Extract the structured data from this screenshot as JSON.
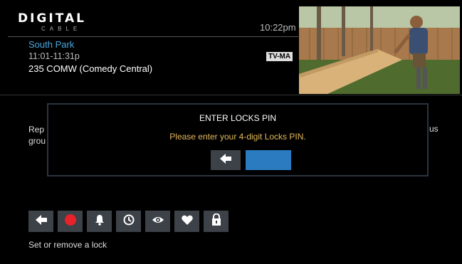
{
  "header": {
    "logo_main": "DIGITAL",
    "logo_sub": "CABLE",
    "time": "10:22pm"
  },
  "program": {
    "title": "South Park",
    "time_range": "11:01-11:31p",
    "channel": "235 COMW (Comedy Central)",
    "rating": "TV-MA"
  },
  "description": {
    "left_line1": "Rep",
    "left_line2": "grou",
    "right_line1": "us"
  },
  "dialog": {
    "title": "ENTER LOCKS PIN",
    "message": "Please enter your 4-digit Locks PIN.",
    "back_icon": "left-arrow-icon",
    "pin_value": ""
  },
  "actions": [
    {
      "icon": "back-arrow-icon"
    },
    {
      "icon": "record-icon",
      "color": "#e8222a"
    },
    {
      "icon": "bell-icon"
    },
    {
      "icon": "clock-icon"
    },
    {
      "icon": "eye-icon"
    },
    {
      "icon": "heart-icon"
    },
    {
      "icon": "lock-icon"
    }
  ],
  "status_text": "Set or remove a lock"
}
